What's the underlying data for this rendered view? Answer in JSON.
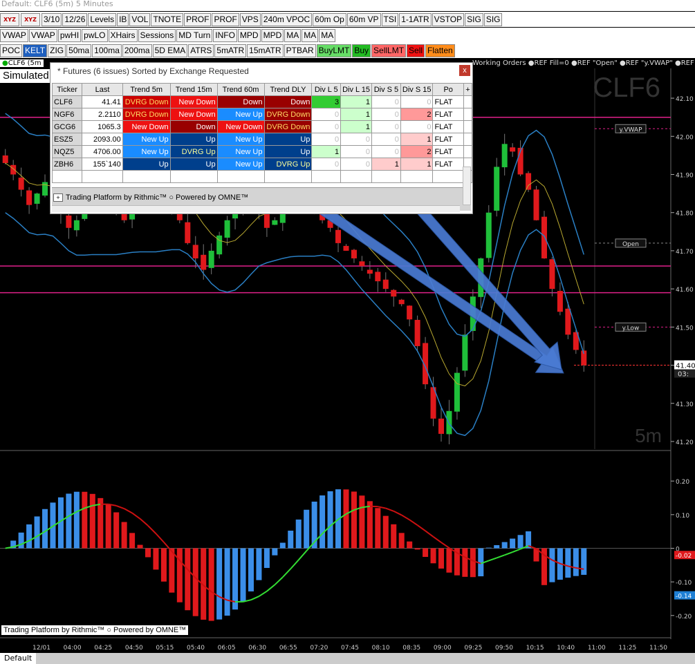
{
  "window": {
    "title": "Default: CLF6 (5m) 5 Minutes"
  },
  "toolbar_row1": [
    "3/10",
    "12/26",
    "Levels",
    "IB",
    "VOL",
    "TNOTE",
    "PROF",
    "PROF",
    "VPS",
    "240m VPOC",
    "60m Op",
    "60m VP",
    "TSI",
    "1-1ATR",
    "VSTOP",
    "SIG",
    "SIG"
  ],
  "toolbar_row2": [
    "VWAP",
    "VWAP",
    "pwHI",
    "pwLO",
    "XHairs",
    "Sessions",
    "MD Turn",
    "INFO",
    "MPD",
    "MPD",
    "MA",
    "MA",
    "MA"
  ],
  "toolbar_row3": [
    {
      "label": "POC",
      "color": "#f2f2f2",
      "text": "#000"
    },
    {
      "label": "KELT",
      "color": "#1e5fbf",
      "text": "#fff"
    },
    {
      "label": "ZIG",
      "color": "#f2f2f2",
      "text": "#000"
    },
    {
      "label": "50ma",
      "color": "#f2f2f2",
      "text": "#000"
    },
    {
      "label": "100ma",
      "color": "#f2f2f2",
      "text": "#000"
    },
    {
      "label": "200ma",
      "color": "#f2f2f2",
      "text": "#000"
    },
    {
      "label": "5D EMA",
      "color": "#f2f2f2",
      "text": "#000"
    },
    {
      "label": "ATRS",
      "color": "#f2f2f2",
      "text": "#000"
    },
    {
      "label": "5mATR",
      "color": "#f2f2f2",
      "text": "#000"
    },
    {
      "label": "15mATR",
      "color": "#f2f2f2",
      "text": "#000"
    },
    {
      "label": "PTBAR",
      "color": "#f2f2f2",
      "text": "#000"
    },
    {
      "label": "BuyLMT",
      "color": "#66dd66",
      "text": "#000"
    },
    {
      "label": "Buy",
      "color": "#22bb22",
      "text": "#000"
    },
    {
      "label": "SellLMT",
      "color": "#ff6666",
      "text": "#000"
    },
    {
      "label": "Sell",
      "color": "#ee1111",
      "text": "#000"
    },
    {
      "label": "Flatten",
      "color": "#ff8c1a",
      "text": "#000"
    }
  ],
  "chart_header": {
    "symbol_tab": "CLF6 (5m",
    "simulated": "Simulated -",
    "orders": "Working Orders  ●REF Fill=0  ●REF \"Open\"  ●REF \"y.VWAP\"  ●REF"
  },
  "chart_watermark": "CLF6",
  "chart_interval": "5m",
  "price_labels": {
    "vwap": "y.VWAP",
    "open": "Open",
    "ylow": "y.Low",
    "last": "41.40",
    "timer": "03:"
  },
  "popup": {
    "title": "* Futures (6 issues) Sorted by Exchange Requested",
    "close": "x",
    "columns": [
      "Ticker",
      "Last",
      "Trend 5m",
      "Trend 15m",
      "Trend 60m",
      "Trend DLY",
      "Div L 5",
      "Div L 15",
      "Div S 5",
      "Div S 15",
      "Po",
      "+"
    ],
    "rows": [
      {
        "ticker": "CLF6",
        "last": "41.41",
        "t5": "DVRG Down",
        "t15": "New Down",
        "t60": "Down",
        "tdly": "Down",
        "dl5": "3",
        "dl15": "1",
        "ds5": "0",
        "ds15": "0",
        "pos": "FLAT",
        "c5": "#cc0000",
        "c15": "#ee1111",
        "c60": "#990000",
        "cdly": "#990000",
        "k5": "#ffdd66",
        "k15": "#fff",
        "k60": "#fff",
        "kdly": "#fff",
        "bdl5": "#33cc33",
        "bdl15": "#ccffcc",
        "bds5": "#fff",
        "bds15": "#fff"
      },
      {
        "ticker": "NGF6",
        "last": "2.2110",
        "t5": "DVRG Down",
        "t15": "New Down",
        "t60": "New Up",
        "tdly": "DVRG Down",
        "dl5": "0",
        "dl15": "1",
        "ds5": "0",
        "ds15": "2",
        "pos": "FLAT",
        "c5": "#cc0000",
        "c15": "#ee1111",
        "c60": "#1a8cff",
        "cdly": "#990000",
        "k5": "#ffdd66",
        "k15": "#fff",
        "k60": "#fff",
        "kdly": "#ffdd66",
        "bdl5": "#fff",
        "bdl15": "#ccffcc",
        "bds5": "#fff",
        "bds15": "#ff9999"
      },
      {
        "ticker": "GCG6",
        "last": "1065.3",
        "t5": "New Down",
        "t15": "Down",
        "t60": "New Down",
        "tdly": "DVRG Down",
        "dl5": "0",
        "dl15": "1",
        "ds5": "0",
        "ds15": "0",
        "pos": "FLAT",
        "c5": "#ee1111",
        "c15": "#990000",
        "c60": "#ee1111",
        "cdly": "#990000",
        "k5": "#fff",
        "k15": "#fff",
        "k60": "#fff",
        "kdly": "#ffdd66",
        "bdl5": "#fff",
        "bdl15": "#ccffcc",
        "bds5": "#fff",
        "bds15": "#fff"
      },
      {
        "ticker": "ESZ5",
        "last": "2093.00",
        "t5": "New Up",
        "t15": "Up",
        "t60": "New Up",
        "tdly": "Up",
        "dl5": "0",
        "dl15": "0",
        "ds5": "0",
        "ds15": "1",
        "pos": "FLAT",
        "c5": "#1a8cff",
        "c15": "#003f8c",
        "c60": "#1a8cff",
        "cdly": "#003f8c",
        "k5": "#fff",
        "k15": "#fff",
        "k60": "#fff",
        "kdly": "#fff",
        "bdl5": "#fff",
        "bdl15": "#fff",
        "bds5": "#fff",
        "bds15": "#ffcccc"
      },
      {
        "ticker": "NQZ5",
        "last": "4706.00",
        "t5": "New Up",
        "t15": "DVRG Up",
        "t60": "New Up",
        "tdly": "Up",
        "dl5": "1",
        "dl15": "0",
        "ds5": "0",
        "ds15": "2",
        "pos": "FLAT",
        "c5": "#1a8cff",
        "c15": "#003f8c",
        "c60": "#1a8cff",
        "cdly": "#003f8c",
        "k5": "#fff",
        "k15": "#ffff99",
        "k60": "#fff",
        "kdly": "#fff",
        "bdl5": "#ccffcc",
        "bdl15": "#fff",
        "bds5": "#fff",
        "bds15": "#ff9999"
      },
      {
        "ticker": "ZBH6",
        "last": "155`140",
        "t5": "Up",
        "t15": "Up",
        "t60": "New Up",
        "tdly": "DVRG Up",
        "dl5": "0",
        "dl15": "0",
        "ds5": "1",
        "ds15": "1",
        "pos": "FLAT",
        "c5": "#003f8c",
        "c15": "#003f8c",
        "c60": "#1a8cff",
        "cdly": "#003f8c",
        "k5": "#fff",
        "k15": "#fff",
        "k60": "#fff",
        "kdly": "#ffff99",
        "bdl5": "#fff",
        "bdl15": "#fff",
        "bds5": "#ffcccc",
        "bds15": "#ffcccc"
      }
    ],
    "footer": "Trading Platform by Rithmic™  ○ Powered by OMNE™"
  },
  "bottom_brand": "Trading Platform by Rithmic™  ○ Powered by OMNE™",
  "status_tab": "Default",
  "chart_data": {
    "type": "candlestick",
    "price_axis": {
      "min": 41.18,
      "max": 42.14,
      "ticks": [
        "42.10",
        "42.00",
        "41.90",
        "41.80",
        "41.70",
        "41.60",
        "41.50",
        "41.40",
        "41.30",
        "41.20"
      ]
    },
    "time_axis": [
      "12/01",
      "04:00",
      "04:25",
      "04:50",
      "05:15",
      "05:40",
      "06:05",
      "06:30",
      "06:55",
      "07:20",
      "07:45",
      "08:10",
      "08:35",
      "09:00",
      "09:25",
      "09:50",
      "10:15",
      "10:40",
      "11:00",
      "11:25",
      "11:50"
    ],
    "levels": [
      {
        "name": "level-42.05",
        "value": 42.05,
        "color": "#e0218a"
      },
      {
        "name": "level-41.66",
        "value": 41.66,
        "color": "#e0218a"
      },
      {
        "name": "level-41.59",
        "value": 41.59,
        "color": "#e0218a"
      },
      {
        "name": "y.VWAP",
        "value": 42.02,
        "color": "#e0218a"
      },
      {
        "name": "Open",
        "value": 41.72,
        "color": "#888888"
      },
      {
        "name": "y.Low",
        "value": 41.5,
        "color": "#e0218a"
      }
    ],
    "osc_axis": {
      "min": -0.26,
      "max": 0.26,
      "ticks": [
        "0.20",
        "0.10",
        "0",
        "-0.10",
        "-0.20"
      ],
      "last_labels": [
        "-0.02",
        "-0.14"
      ]
    }
  }
}
